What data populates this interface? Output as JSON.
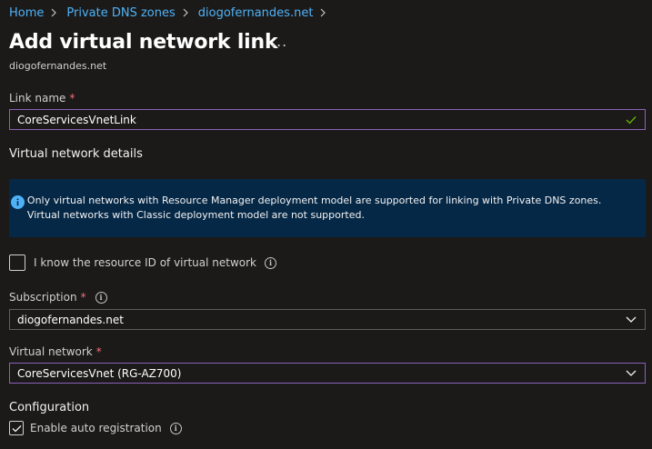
{
  "breadcrumb": {
    "items": [
      "Home",
      "Private DNS zones",
      "diogofernandes.net"
    ]
  },
  "page": {
    "title": "Add virtual network link",
    "more_label": "...",
    "subtitle": "diogofernandes.net"
  },
  "link_name": {
    "label": "Link name",
    "required_mark": "*",
    "value": "CoreServicesVnetLink"
  },
  "vnet_details": {
    "heading": "Virtual network details",
    "info_text": "Only virtual networks with Resource Manager deployment model are supported for linking with Private DNS zones. Virtual networks with Classic deployment model are not supported."
  },
  "resource_id_checkbox": {
    "label": "I know the resource ID of virtual network",
    "checked": false
  },
  "subscription": {
    "label": "Subscription",
    "required_mark": "*",
    "value": "diogofernandes.net"
  },
  "virtual_network": {
    "label": "Virtual network",
    "required_mark": "*",
    "value": "CoreServicesVnet (RG-AZ700)"
  },
  "configuration": {
    "heading": "Configuration",
    "auto_registration_label": "Enable auto registration",
    "auto_registration_checked": true
  },
  "colors": {
    "background": "#1b1a19",
    "link": "#4fb2f7",
    "focus_border": "#8a61b8",
    "info_banner": "#052847",
    "valid_check": "#6bb700",
    "required": "#f1707b"
  },
  "icons": {
    "breadcrumb_separator": "chevron-right-icon",
    "valid": "checkmark-icon",
    "info": "info-icon",
    "dropdown": "chevron-down-icon"
  }
}
